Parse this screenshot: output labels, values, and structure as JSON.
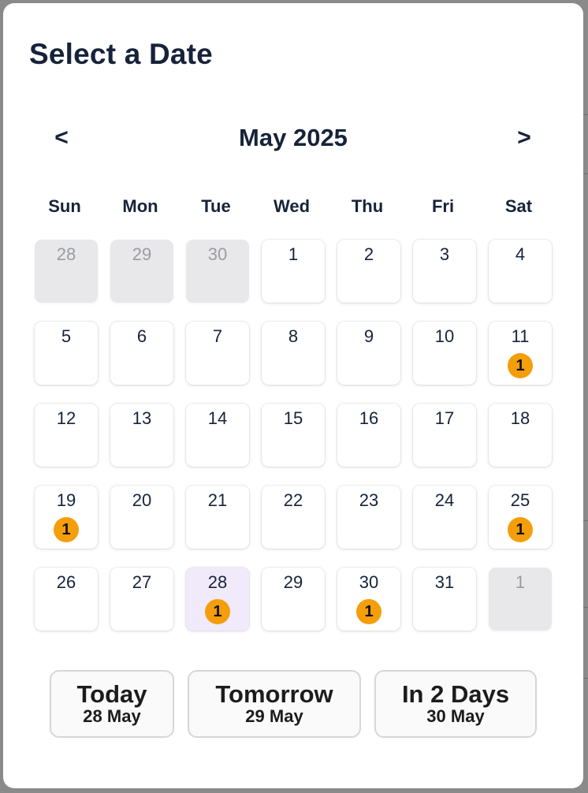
{
  "modal": {
    "title": "Select a Date"
  },
  "nav": {
    "prev_label": "<",
    "next_label": ">",
    "month_label": "May 2025"
  },
  "weekdays": [
    "Sun",
    "Mon",
    "Tue",
    "Wed",
    "Thu",
    "Fri",
    "Sat"
  ],
  "weeks": [
    [
      {
        "day": "28",
        "outside": true
      },
      {
        "day": "29",
        "outside": true
      },
      {
        "day": "30",
        "outside": true
      },
      {
        "day": "1"
      },
      {
        "day": "2"
      },
      {
        "day": "3"
      },
      {
        "day": "4"
      }
    ],
    [
      {
        "day": "5"
      },
      {
        "day": "6"
      },
      {
        "day": "7"
      },
      {
        "day": "8"
      },
      {
        "day": "9"
      },
      {
        "day": "10"
      },
      {
        "day": "11",
        "badge": "1"
      }
    ],
    [
      {
        "day": "12"
      },
      {
        "day": "13"
      },
      {
        "day": "14"
      },
      {
        "day": "15"
      },
      {
        "day": "16"
      },
      {
        "day": "17"
      },
      {
        "day": "18"
      }
    ],
    [
      {
        "day": "19",
        "badge": "1"
      },
      {
        "day": "20"
      },
      {
        "day": "21"
      },
      {
        "day": "22"
      },
      {
        "day": "23"
      },
      {
        "day": "24"
      },
      {
        "day": "25",
        "badge": "1"
      }
    ],
    [
      {
        "day": "26"
      },
      {
        "day": "27"
      },
      {
        "day": "28",
        "selected": true,
        "badge": "1"
      },
      {
        "day": "29"
      },
      {
        "day": "30",
        "badge": "1"
      },
      {
        "day": "31"
      },
      {
        "day": "1",
        "outside": true
      }
    ]
  ],
  "quick_picks": {
    "today": {
      "label": "Today",
      "date": "28 May"
    },
    "tomorrow": {
      "label": "Tomorrow",
      "date": "29 May"
    },
    "in_2_days": {
      "label": "In 2 Days",
      "date": "30 May"
    }
  },
  "colors": {
    "badge": "#f59e0b",
    "selected_day": "#f1eafb",
    "outside_day": "#e8e8ea",
    "text": "#16233a"
  }
}
